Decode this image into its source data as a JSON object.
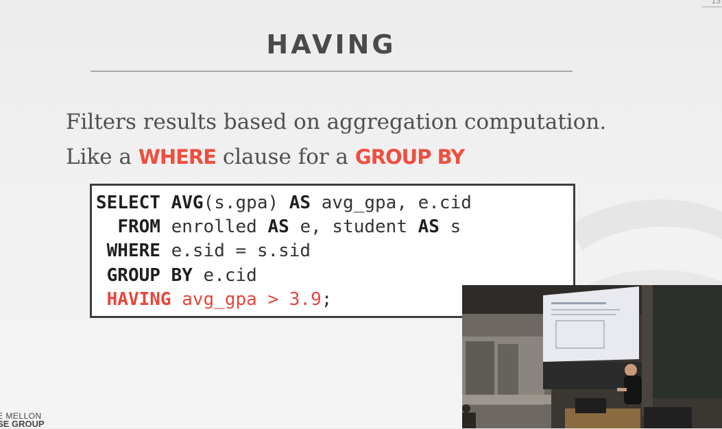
{
  "slide": {
    "page_number": "13",
    "title": "HAVING",
    "line1": "Filters results based on aggregation computation.",
    "line2": {
      "part1": "Like a ",
      "kw1": "WHERE",
      "part2": " clause for a ",
      "kw2": "GROUP BY"
    },
    "code": {
      "l1": {
        "kw1": "SELECT",
        "kw2": "AVG",
        "t1": "(s.gpa) ",
        "kw3": "AS",
        "t2": " avg_gpa, e.cid"
      },
      "l2": {
        "indent": "  ",
        "kw1": "FROM",
        "t1": " enrolled ",
        "kw2": "AS",
        "t2": " e, student ",
        "kw3": "AS",
        "t3": " s"
      },
      "l3": {
        "indent": " ",
        "kw1": "WHERE",
        "t1": " e.sid = s.sid"
      },
      "l4": {
        "indent": " ",
        "kw1": "GROUP BY",
        "t1": " e.cid"
      },
      "l5": {
        "indent": " ",
        "kw1": "HAVING",
        "t1": " avg_gpa > 3.9",
        "t2": ";"
      }
    },
    "logo": {
      "line1": "E MELLON",
      "line2": "SE GROUP"
    }
  },
  "colors": {
    "accent_red": "#ef4f3f",
    "title_gray": "#4a4a4a",
    "code_border": "#3d3d3d"
  },
  "webcam": {
    "description_icon": "lecture-video-feed"
  }
}
